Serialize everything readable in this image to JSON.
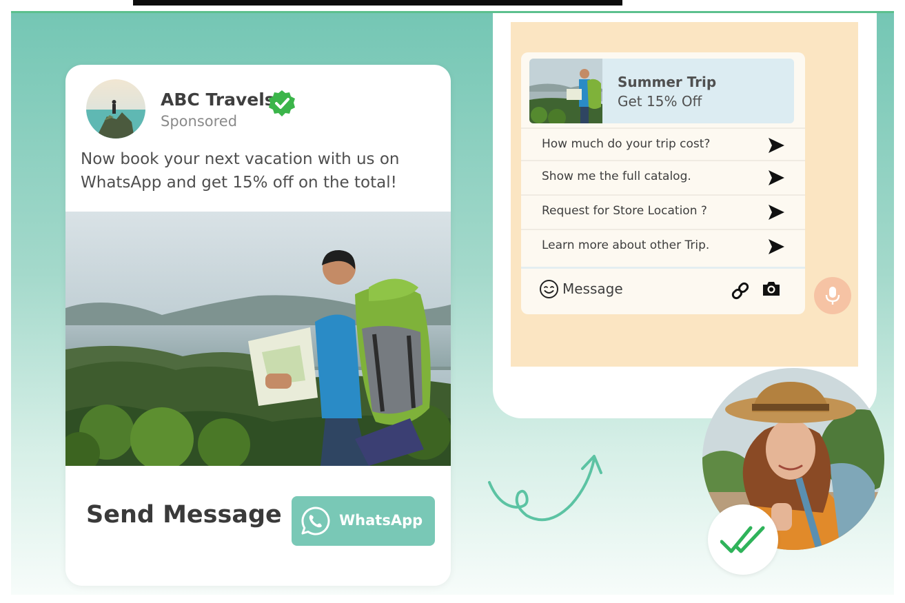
{
  "ad": {
    "brand_name": "ABC Travels",
    "sponsored_label": "Sponsored",
    "body_text": "Now book your next vacation with us on WhatsApp and get 15% off on the total!",
    "cta_label": "Send Message",
    "whatsapp_button_label": "WhatsApp"
  },
  "chat": {
    "promo_title": "Summer Trip",
    "promo_subtitle": "Get 15% Off",
    "quick_replies": [
      {
        "label": "How much do your trip cost?"
      },
      {
        "label": "Show me the full catalog."
      },
      {
        "label": "Request for Store Location ?"
      },
      {
        "label": "Learn more about other Trip."
      }
    ],
    "compose_placeholder": "Message"
  },
  "colors": {
    "brand_teal": "#79c8b6",
    "verified_green": "#3bb54a",
    "chat_background": "#fbe5c2",
    "mic_button": "#f6c3a4",
    "check_green": "#2fb35a"
  },
  "icons": {
    "verified": "verified-badge-icon",
    "whatsapp": "whatsapp-icon",
    "send": "send-icon",
    "smiley": "smiley-icon",
    "link": "link-icon",
    "camera": "camera-icon",
    "mic": "microphone-icon",
    "read_receipt": "double-check-icon"
  }
}
